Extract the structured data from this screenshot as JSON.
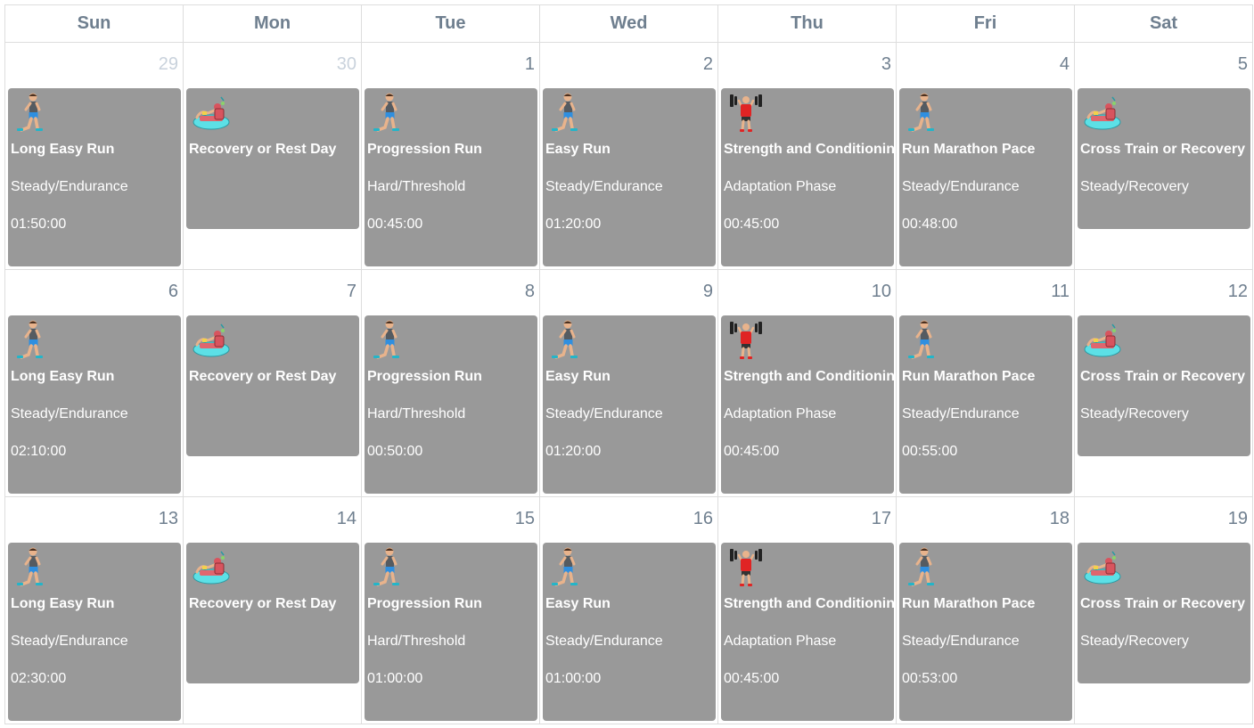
{
  "headers": [
    "Sun",
    "Mon",
    "Tue",
    "Wed",
    "Thu",
    "Fri",
    "Sat"
  ],
  "weeks": [
    {
      "days": [
        {
          "date": "29",
          "other_month": true,
          "event": {
            "icon": "runner-icon",
            "title": "Long Easy Run",
            "subtitle": "Steady/Endurance",
            "duration": "01:50:00"
          }
        },
        {
          "date": "30",
          "other_month": true,
          "event": {
            "icon": "rest-icon",
            "title": "Recovery or Rest Day",
            "subtitle": "",
            "duration": ""
          }
        },
        {
          "date": "1",
          "other_month": false,
          "event": {
            "icon": "runner-icon",
            "title": "Progression Run",
            "subtitle": "Hard/Threshold",
            "duration": "00:45:00"
          }
        },
        {
          "date": "2",
          "other_month": false,
          "event": {
            "icon": "runner-icon",
            "title": "Easy Run",
            "subtitle": "Steady/Endurance",
            "duration": "01:20:00"
          }
        },
        {
          "date": "3",
          "other_month": false,
          "event": {
            "icon": "weightlifter-icon",
            "title": "Strength and Conditioning",
            "subtitle": "Adaptation Phase",
            "duration": "00:45:00"
          }
        },
        {
          "date": "4",
          "other_month": false,
          "event": {
            "icon": "runner-icon",
            "title": "Run Marathon Pace",
            "subtitle": "Steady/Endurance",
            "duration": "00:48:00"
          }
        },
        {
          "date": "5",
          "other_month": false,
          "event": {
            "icon": "rest-icon",
            "title": "Cross Train or Recovery",
            "subtitle": "Steady/Recovery",
            "duration": ""
          }
        }
      ]
    },
    {
      "days": [
        {
          "date": "6",
          "other_month": false,
          "event": {
            "icon": "runner-icon",
            "title": "Long Easy Run",
            "subtitle": "Steady/Endurance",
            "duration": "02:10:00"
          }
        },
        {
          "date": "7",
          "other_month": false,
          "event": {
            "icon": "rest-icon",
            "title": "Recovery or Rest Day",
            "subtitle": "",
            "duration": ""
          }
        },
        {
          "date": "8",
          "other_month": false,
          "event": {
            "icon": "runner-icon",
            "title": "Progression Run",
            "subtitle": "Hard/Threshold",
            "duration": "00:50:00"
          }
        },
        {
          "date": "9",
          "other_month": false,
          "event": {
            "icon": "runner-icon",
            "title": "Easy Run",
            "subtitle": "Steady/Endurance",
            "duration": "01:20:00"
          }
        },
        {
          "date": "10",
          "other_month": false,
          "event": {
            "icon": "weightlifter-icon",
            "title": "Strength and Conditioning",
            "subtitle": "Adaptation Phase",
            "duration": "00:45:00"
          }
        },
        {
          "date": "11",
          "other_month": false,
          "event": {
            "icon": "runner-icon",
            "title": "Run Marathon Pace",
            "subtitle": "Steady/Endurance",
            "duration": "00:55:00"
          }
        },
        {
          "date": "12",
          "other_month": false,
          "event": {
            "icon": "rest-icon",
            "title": "Cross Train or Recovery",
            "subtitle": "Steady/Recovery",
            "duration": ""
          }
        }
      ]
    },
    {
      "days": [
        {
          "date": "13",
          "other_month": false,
          "event": {
            "icon": "runner-icon",
            "title": "Long Easy Run",
            "subtitle": "Steady/Endurance",
            "duration": "02:30:00"
          }
        },
        {
          "date": "14",
          "other_month": false,
          "event": {
            "icon": "rest-icon",
            "title": "Recovery or Rest Day",
            "subtitle": "",
            "duration": ""
          }
        },
        {
          "date": "15",
          "other_month": false,
          "event": {
            "icon": "runner-icon",
            "title": "Progression Run",
            "subtitle": "Hard/Threshold",
            "duration": "01:00:00"
          }
        },
        {
          "date": "16",
          "other_month": false,
          "event": {
            "icon": "runner-icon",
            "title": "Easy Run",
            "subtitle": "Steady/Endurance",
            "duration": "01:00:00"
          }
        },
        {
          "date": "17",
          "other_month": false,
          "event": {
            "icon": "weightlifter-icon",
            "title": "Strength and Conditioning",
            "subtitle": "Adaptation Phase",
            "duration": "00:45:00"
          }
        },
        {
          "date": "18",
          "other_month": false,
          "event": {
            "icon": "runner-icon",
            "title": "Run Marathon Pace",
            "subtitle": "Steady/Endurance",
            "duration": "00:53:00"
          }
        },
        {
          "date": "19",
          "other_month": false,
          "event": {
            "icon": "rest-icon",
            "title": "Cross Train or Recovery",
            "subtitle": "Steady/Recovery",
            "duration": ""
          }
        }
      ]
    }
  ]
}
